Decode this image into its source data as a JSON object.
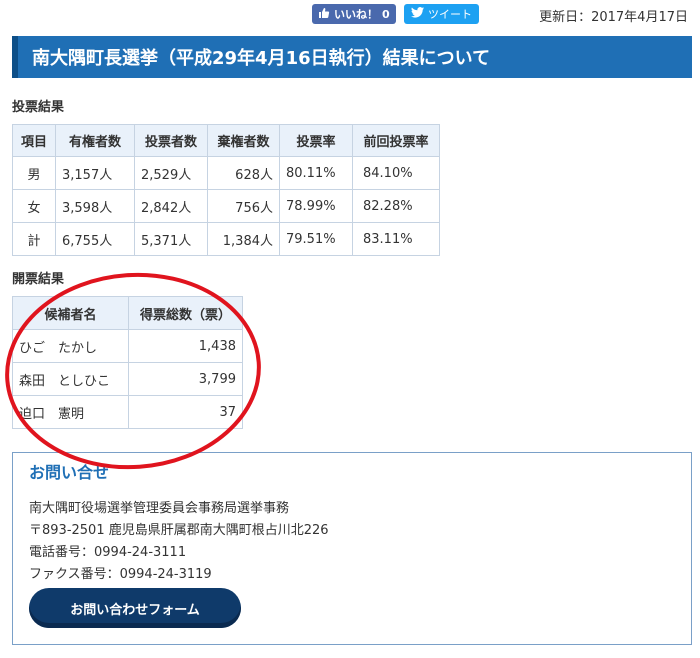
{
  "topbar": {
    "like_label": "いいね！",
    "like_count": "0",
    "tweet_label": "ツイート",
    "updated": "更新日：2017年4月17日"
  },
  "page_title": "南大隅町長選挙（平成29年4月16日執行）結果について",
  "turnout": {
    "heading": "投票結果",
    "columns": [
      "項目",
      "有権者数",
      "投票者数",
      "棄権者数",
      "投票率",
      "前回投票率"
    ],
    "rows": [
      [
        "男",
        "3,157人",
        "2,529人",
        "628人",
        "80.11%",
        "84.10%"
      ],
      [
        "女",
        "3,598人",
        "2,842人",
        "756人",
        "78.99%",
        "82.28%"
      ],
      [
        "計",
        "6,755人",
        "5,371人",
        "1,384人",
        "79.51%",
        "83.11%"
      ]
    ]
  },
  "count": {
    "heading": "開票結果",
    "columns": [
      "候補者名",
      "得票総数（票）"
    ],
    "rows": [
      [
        "ひご　たかし",
        "1,438"
      ],
      [
        "森田　としひこ",
        "3,799"
      ],
      [
        "迫口　憲明",
        "37"
      ]
    ]
  },
  "contact": {
    "title": "お問い合せ",
    "lines": [
      "南大隅町役場選挙管理委員会事務局選挙事務",
      "〒893-2501 鹿児島県肝属郡南大隅町根占川北226",
      "電話番号：0994-24-3111",
      "ファクス番号：0994-24-3119"
    ],
    "form_button": "お問い合わせフォーム"
  },
  "colors": {
    "title_bar": "#1f6fb5",
    "annotation_circle": "#e0141e"
  }
}
